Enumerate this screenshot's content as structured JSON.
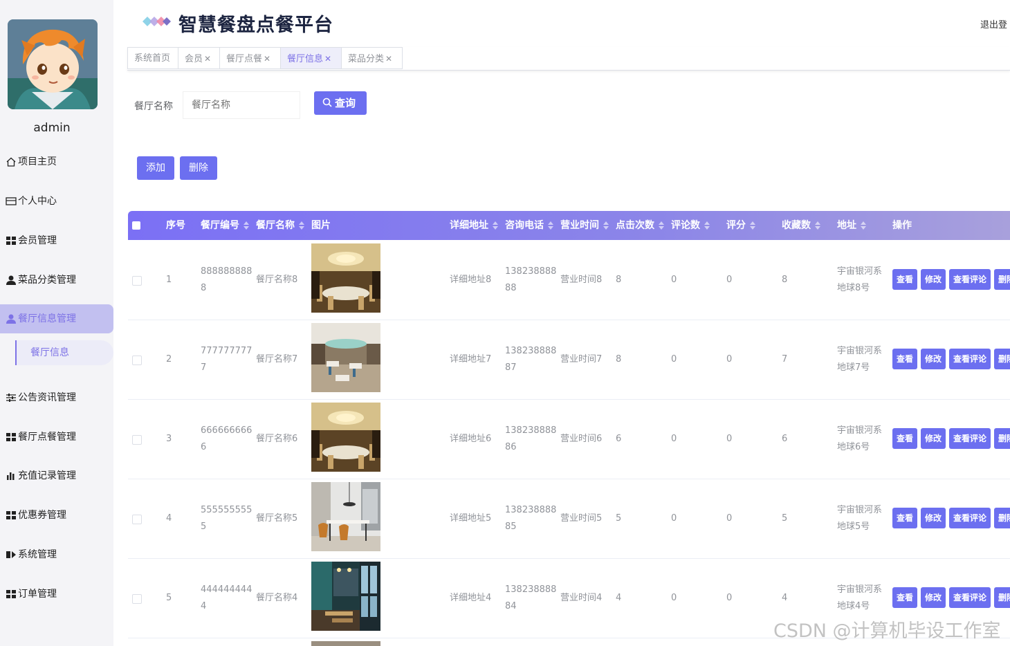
{
  "app": {
    "title": "智慧餐盘点餐平台",
    "logout": "退出登"
  },
  "user": {
    "name": "admin"
  },
  "sidebar": {
    "items": [
      {
        "label": "项目主页",
        "icon": "home-icon"
      },
      {
        "label": "个人中心",
        "icon": "id-card-icon"
      },
      {
        "label": "会员管理",
        "icon": "grid-icon"
      },
      {
        "label": "菜品分类管理",
        "icon": "user-icon"
      },
      {
        "label": "餐厅信息管理",
        "icon": "user-icon"
      },
      {
        "label": "公告资讯管理",
        "icon": "sliders-icon"
      },
      {
        "label": "餐厅点餐管理",
        "icon": "grid-icon"
      },
      {
        "label": "充值记录管理",
        "icon": "bar-chart-icon"
      },
      {
        "label": "优惠券管理",
        "icon": "grid-icon"
      },
      {
        "label": "系统管理",
        "icon": "system-icon"
      },
      {
        "label": "订单管理",
        "icon": "grid-icon"
      }
    ],
    "sub_item": "餐厅信息",
    "active_index": 4
  },
  "tabs": [
    {
      "label": "系统首页",
      "closable": false
    },
    {
      "label": "会员",
      "closable": true
    },
    {
      "label": "餐厅点餐",
      "closable": true
    },
    {
      "label": "餐厅信息",
      "closable": true,
      "active": true
    },
    {
      "label": "菜品分类",
      "closable": true
    }
  ],
  "search": {
    "label": "餐厅名称",
    "placeholder": "餐厅名称",
    "value": "",
    "button": "查询"
  },
  "actions": {
    "add": "添加",
    "delete": "删除"
  },
  "table": {
    "columns": [
      "序号",
      "餐厅编号",
      "餐厅名称",
      "图片",
      "详细地址",
      "咨询电话",
      "营业时间",
      "点击次数",
      "评论数",
      "评分",
      "收藏数",
      "地址",
      "操作"
    ],
    "row_actions": [
      "查看",
      "修改",
      "查看评论",
      "删除"
    ],
    "rows": [
      {
        "index": "1",
        "code": [
          "888888888",
          "8"
        ],
        "name": "餐厅名称8",
        "image": "restaurant-interior-1",
        "detail_addr": "详细地址8",
        "phone": [
          "138238888",
          "88"
        ],
        "hours": "营业时间8",
        "clicks": "8",
        "comments": "0",
        "rating": "0",
        "favorites": "8",
        "address": [
          "宇宙银河系",
          "地球8号"
        ]
      },
      {
        "index": "2",
        "code": [
          "777777777",
          "7"
        ],
        "name": "餐厅名称7",
        "image": "restaurant-interior-2",
        "detail_addr": "详细地址7",
        "phone": [
          "138238888",
          "87"
        ],
        "hours": "营业时间7",
        "clicks": "8",
        "comments": "0",
        "rating": "0",
        "favorites": "7",
        "address": [
          "宇宙银河系",
          "地球7号"
        ]
      },
      {
        "index": "3",
        "code": [
          "666666666",
          "6"
        ],
        "name": "餐厅名称6",
        "image": "restaurant-interior-1",
        "detail_addr": "详细地址6",
        "phone": [
          "138238888",
          "86"
        ],
        "hours": "营业时间6",
        "clicks": "6",
        "comments": "0",
        "rating": "0",
        "favorites": "6",
        "address": [
          "宇宙银河系",
          "地球6号"
        ]
      },
      {
        "index": "4",
        "code": [
          "555555555",
          "5"
        ],
        "name": "餐厅名称5",
        "image": "restaurant-interior-3",
        "detail_addr": "详细地址5",
        "phone": [
          "138238888",
          "85"
        ],
        "hours": "营业时间5",
        "clicks": "5",
        "comments": "0",
        "rating": "0",
        "favorites": "5",
        "address": [
          "宇宙银河系",
          "地球5号"
        ]
      },
      {
        "index": "5",
        "code": [
          "444444444",
          "4"
        ],
        "name": "餐厅名称4",
        "image": "restaurant-interior-4",
        "detail_addr": "详细地址4",
        "phone": [
          "138238888",
          "84"
        ],
        "hours": "营业时间4",
        "clicks": "4",
        "comments": "0",
        "rating": "0",
        "favorites": "4",
        "address": [
          "宇宙银河系",
          "地球4号"
        ]
      }
    ]
  },
  "watermark": "CSDN @计算机毕设工作室",
  "colors": {
    "accent": "#6c6ff0",
    "active_menu": "#c2c0f0",
    "title": "#1d2541"
  }
}
